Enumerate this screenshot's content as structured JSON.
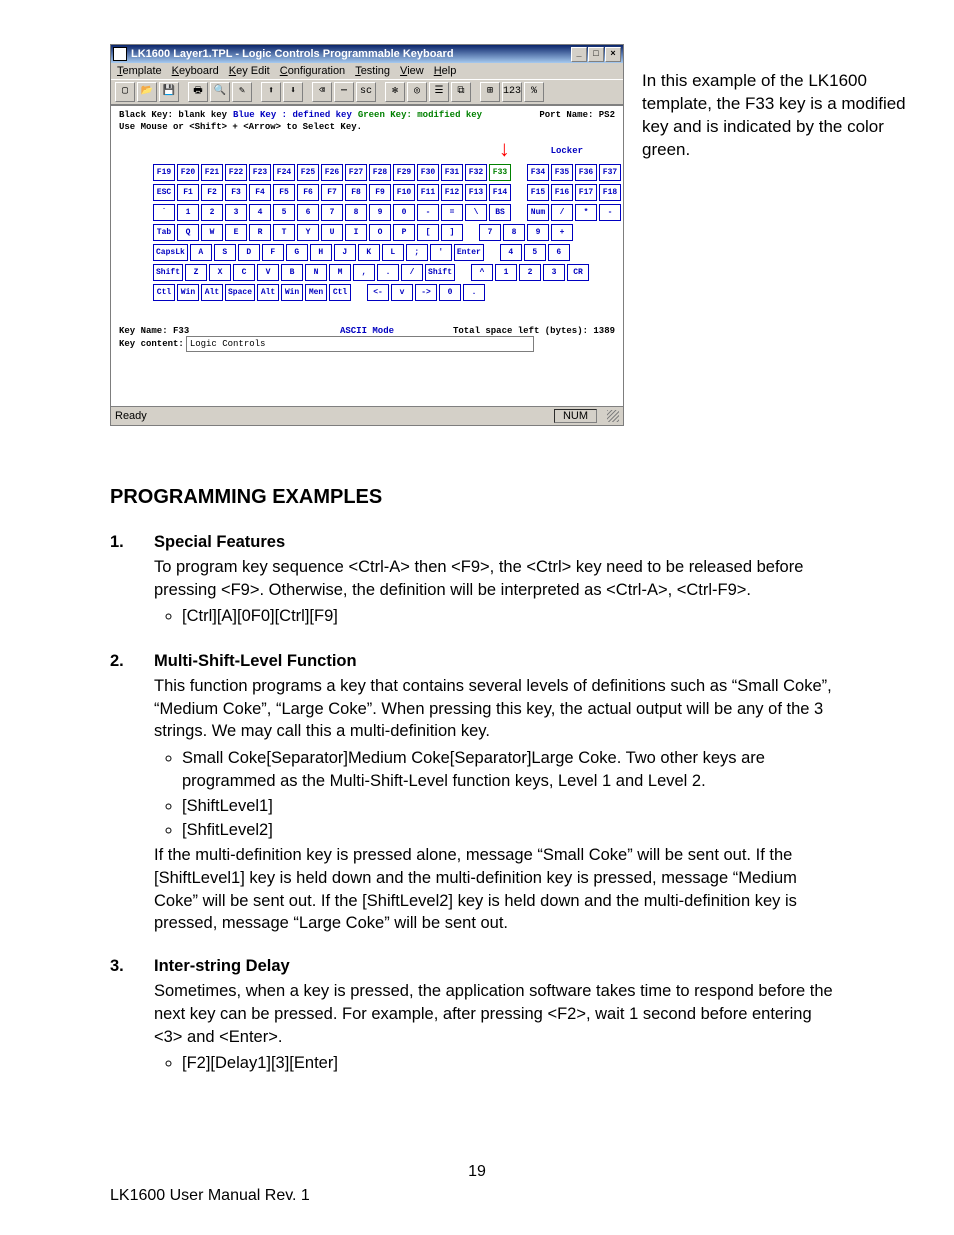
{
  "window": {
    "title": "LK1600 Layer1.TPL - Logic Controls Programmable Keyboard",
    "buttons": {
      "min": "_",
      "max": "□",
      "close": "×"
    },
    "menus": [
      "Template",
      "Keyboard",
      "Key Edit",
      "Configuration",
      "Testing",
      "View",
      "Help"
    ],
    "legend": {
      "black": "Black Key: blank key",
      "blue": "Blue Key : defined key",
      "green": "Green Key: modified key",
      "port": "Port Name: PS2"
    },
    "hint": "Use Mouse or <Shift> + <Arrow> to Select Key.",
    "locker": "Locker",
    "kb": {
      "row_f_top": [
        "F19",
        "F20",
        "F21",
        "F22",
        "F23",
        "F24",
        "F25",
        "F26",
        "F27",
        "F28",
        "F29",
        "F30",
        "F31",
        "F32",
        "F33"
      ],
      "row_f_top_right": [
        "F34",
        "F35",
        "F36",
        "F37"
      ],
      "row_f": [
        "ESC",
        "F1",
        "F2",
        "F3",
        "F4",
        "F5",
        "F6",
        "F7",
        "F8",
        "F9",
        "F10",
        "F11",
        "F12",
        "F13",
        "F14"
      ],
      "row_f_right": [
        "F15",
        "F16",
        "F17",
        "F18"
      ],
      "row_num": [
        "`",
        "1",
        "2",
        "3",
        "4",
        "5",
        "6",
        "7",
        "8",
        "9",
        "0",
        "-",
        "=",
        "\\",
        "BS"
      ],
      "row_num_right": [
        "Num",
        "/",
        "*",
        "-"
      ],
      "row_q": [
        "Tab",
        "Q",
        "W",
        "E",
        "R",
        "T",
        "Y",
        "U",
        "I",
        "O",
        "P",
        "[",
        "]"
      ],
      "row_q_right": [
        "7",
        "8",
        "9",
        "+"
      ],
      "row_a": [
        "CapsLk",
        "A",
        "S",
        "D",
        "F",
        "G",
        "H",
        "J",
        "K",
        "L",
        ";",
        "'",
        "Enter"
      ],
      "row_a_right": [
        "4",
        "5",
        "6"
      ],
      "row_z": [
        "Shift",
        "Z",
        "X",
        "C",
        "V",
        "B",
        "N",
        "M",
        ",",
        ".",
        "/",
        "Shift"
      ],
      "row_z_right": [
        "^",
        "1",
        "2",
        "3",
        "CR"
      ],
      "row_ctl": [
        "Ctl",
        "Win",
        "Alt",
        "Space",
        "Alt",
        "Win",
        "Men",
        "Ctl"
      ],
      "row_ctl_right": [
        "<-",
        "v",
        "->",
        "0",
        "."
      ]
    },
    "info": {
      "keyname_lbl": "Key Name:",
      "keyname_val": "F33",
      "mode": "ASCII Mode",
      "space": "Total space left (bytes): 1389",
      "content_lbl": "Key content:",
      "content_val": "Logic Controls"
    },
    "status": {
      "ready": "Ready",
      "num": "NUM"
    }
  },
  "caption": "In this example of the LK1600 template, the F33 key is a modified key and is indicated by the color green.",
  "heading": "PROGRAMMING EXAMPLES",
  "examples": [
    {
      "n": "1.",
      "title": "Special Features",
      "paras": [
        "To program key sequence <Ctrl-A> then <F9>, the <Ctrl> key need to be released before pressing <F9>. Otherwise, the definition will be interpreted as <Ctrl-A>, <Ctrl-F9>."
      ],
      "bullets": [
        "[Ctrl][A][0F0][Ctrl][F9]"
      ]
    },
    {
      "n": "2.",
      "title": "Multi-Shift-Level Function",
      "paras": [
        "This function programs a key that contains several levels of definitions such as “Small Coke”, “Medium Coke”, “Large Coke”. When pressing this key, the actual output will be any of the 3 strings. We may call this a multi-definition key."
      ],
      "bullets": [
        "Small Coke[Separator]Medium Coke[Separator]Large Coke. Two other keys are programmed as the Multi-Shift-Level function keys, Level 1 and Level 2.",
        "[ShiftLevel1]",
        "[ShfitLevel2]"
      ],
      "after": "If the multi-definition key is pressed alone, message “Small Coke” will be sent out. If the [ShiftLevel1] key is held down and the multi-definition key is pressed, message “Medium Coke” will be sent out. If the [ShiftLevel2] key is held down and the multi-definition key is pressed, message “Large Coke” will be sent out."
    },
    {
      "n": "3.",
      "title": "Inter-string Delay",
      "paras": [
        "Sometimes, when a key is pressed, the application software takes time to respond before the next key can be pressed. For example, after pressing <F2>, wait 1 second before entering <3> and <Enter>."
      ],
      "bullets": [
        "[F2][Delay1][3][Enter]"
      ]
    }
  ],
  "page_number": "19",
  "footer": "LK1600 User Manual Rev. 1"
}
